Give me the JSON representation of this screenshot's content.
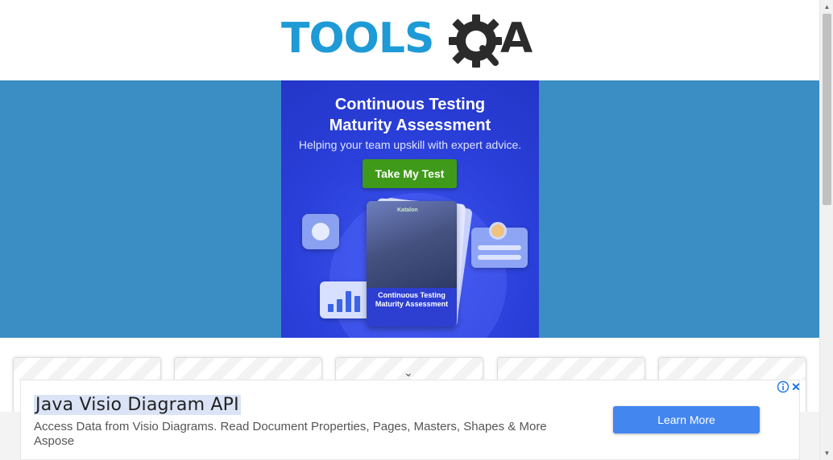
{
  "header": {
    "logo_text_tools": "TOOLS",
    "logo_text_a": "A"
  },
  "banner_ad": {
    "title_line1": "Continuous Testing",
    "title_line2": "Maturity Assessment",
    "subtitle": "Helping your team upskill with expert advice.",
    "button_label": "Take My Test",
    "card_brand": "Katalon",
    "card_title_line1": "Continuous Testing",
    "card_title_line2": "Maturity Assessment"
  },
  "cards": {
    "chevron": "⌄"
  },
  "bottom_ad": {
    "headline": "Java Visio Diagram API",
    "description": "Access Data from Visio Diagrams. Read Document Properties, Pages, Masters, Shapes & More",
    "brand": "Aspose",
    "cta_label": "Learn More",
    "close_label": "✕"
  },
  "colors": {
    "brand_blue": "#1e9ad6",
    "band_blue": "#3a8ec4",
    "cta_blue": "#4386f0",
    "ad_green": "#3f9a1a"
  }
}
